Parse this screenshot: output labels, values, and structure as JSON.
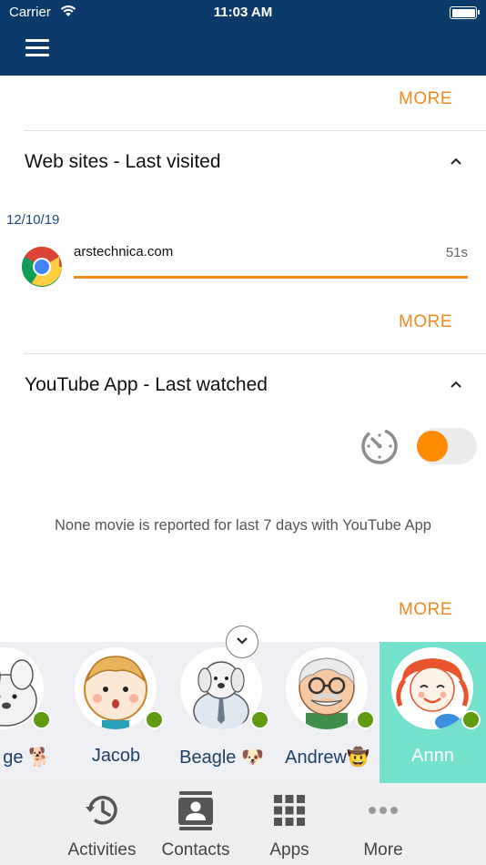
{
  "status_bar": {
    "carrier": "Carrier",
    "time": "11:03 AM"
  },
  "sections": {
    "top_more": "MORE",
    "web": {
      "title": "Web sites - Last visited",
      "date": "12/10/19",
      "site": {
        "name": "arstechnica.com",
        "duration": "51s",
        "usage_fraction": 1.0
      },
      "more": "MORE"
    },
    "youtube": {
      "title": "YouTube App - Last watched",
      "empty_message": "None movie is reported for last 7 days with YouTube App",
      "more": "MORE",
      "toggle_on": true
    }
  },
  "contacts": [
    {
      "name": "ge 🐕",
      "avatar": "dog-avatar",
      "online": true,
      "active": false
    },
    {
      "name": "Jacob",
      "avatar": "boy-avatar",
      "online": true,
      "active": false
    },
    {
      "name": "Beagle 🐶",
      "avatar": "beagle-avatar",
      "online": true,
      "active": false
    },
    {
      "name": "Andrew🤠",
      "avatar": "grandpa-avatar",
      "online": true,
      "active": false
    },
    {
      "name": "Annn",
      "avatar": "girl-avatar",
      "online": true,
      "active": true
    }
  ],
  "tabs": [
    {
      "label": "Activities",
      "icon": "history-icon"
    },
    {
      "label": "Contacts",
      "icon": "contact-card-icon"
    },
    {
      "label": "Apps",
      "icon": "apps-grid-icon"
    },
    {
      "label": "More",
      "icon": "more-dots-icon"
    }
  ],
  "colors": {
    "navbar": "#0b3a6b",
    "accent": "#f5881f",
    "active_contact": "#74e1cd",
    "online": "#5f9a10"
  }
}
